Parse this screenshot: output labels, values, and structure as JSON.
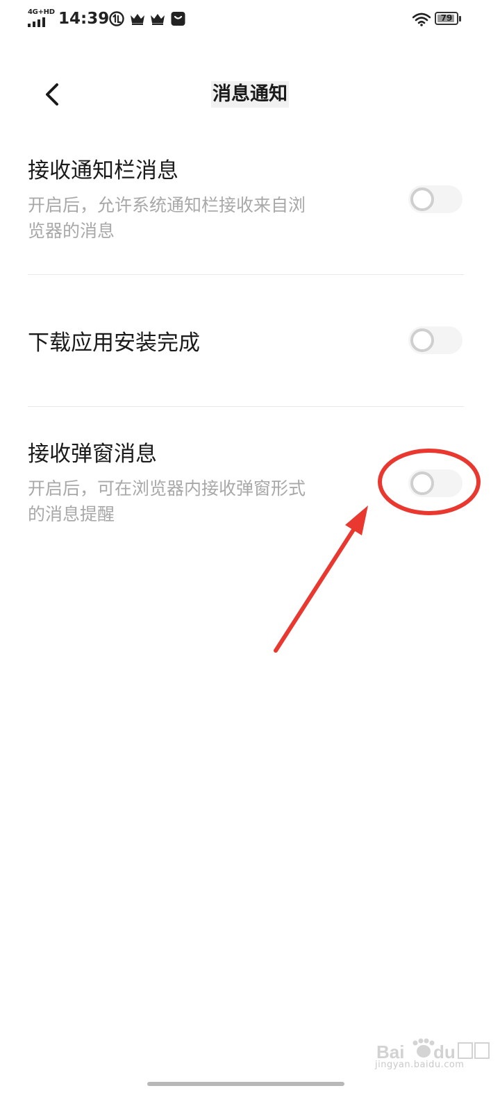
{
  "status_bar": {
    "network": "4G+HD",
    "time": "14:39",
    "battery": "79",
    "icons": [
      "signal-bars-icon",
      "data-usage-icon",
      "crown-icon",
      "crown-icon",
      "bag-icon",
      "wifi-icon",
      "battery-icon"
    ]
  },
  "header": {
    "back_icon": "chevron-left-icon",
    "title": "消息通知"
  },
  "settings": [
    {
      "title": "接收通知栏消息",
      "description_line1": "开启后，允许系统通知栏接收来自浏",
      "description_line2": "览器的消息",
      "enabled": false
    },
    {
      "title": "下载应用安装完成",
      "enabled": false
    },
    {
      "title": "接收弹窗消息",
      "description_line1": "开启后，可在浏览器内接收弹窗形式",
      "description_line2": "的消息提醒",
      "enabled": false
    }
  ],
  "annotation": {
    "color": "#e8382f",
    "shapes": [
      "ellipse-highlight",
      "arrow"
    ]
  },
  "watermark": {
    "text": "jingyan.baidu.com"
  },
  "colors": {
    "background": "#ffffff",
    "title_text": "#1a1a1a",
    "secondary_text": "#a8a8a8",
    "divider": "#e8e8e8",
    "toggle_off_track": "#f4f4f4",
    "toggle_off_knob_border": "#cfcfcf"
  }
}
